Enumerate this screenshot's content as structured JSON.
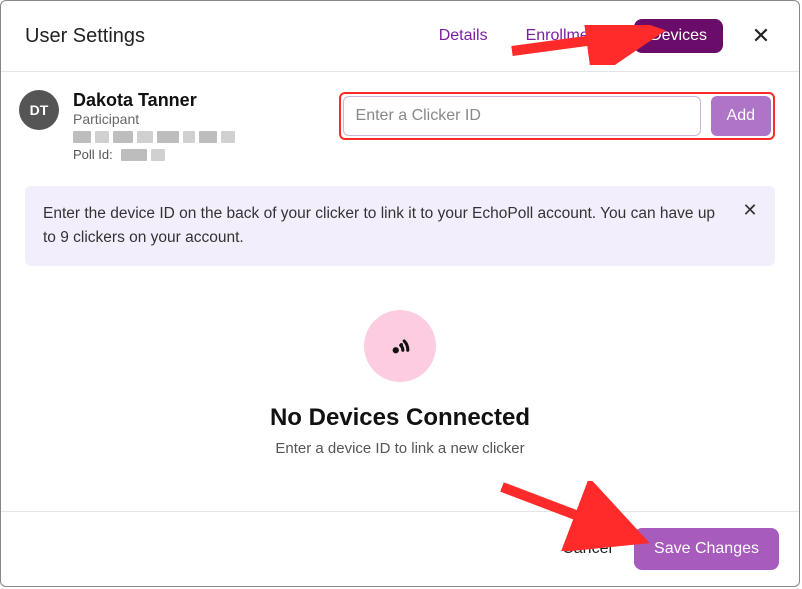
{
  "header": {
    "title": "User Settings",
    "tabs": {
      "details": "Details",
      "enrollments": "Enrollments",
      "devices": "Devices"
    }
  },
  "user": {
    "initials": "DT",
    "name": "Dakota Tanner",
    "role": "Participant",
    "poll_id_label": "Poll Id:"
  },
  "device_form": {
    "placeholder": "Enter a Clicker ID",
    "add_label": "Add"
  },
  "banner": {
    "text": "Enter the device ID on the back of your clicker to link it to your EchoPoll account. You can have up to 9 clickers on your account."
  },
  "empty_state": {
    "title": "No Devices Connected",
    "subtitle": "Enter a device ID to link a new clicker"
  },
  "footer": {
    "cancel": "Cancel",
    "save": "Save Changes"
  }
}
